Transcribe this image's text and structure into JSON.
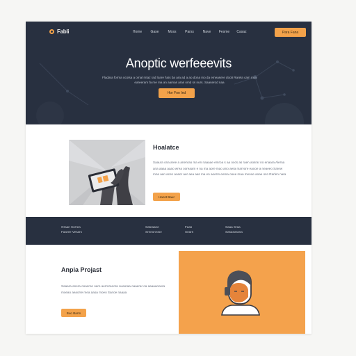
{
  "brand": {
    "name": "Fabli",
    "accent_color": "#f3a24a",
    "dark_color": "#283040"
  },
  "nav": {
    "items": [
      "Home",
      "Gase",
      "Moss",
      "Parss",
      "Nave",
      "Fesme",
      "Casaz",
      "Rerverar"
    ],
    "cta_label": "Para Fana"
  },
  "hero": {
    "title": "Anoptic werfeeevits",
    "subtitle": "Fladara forma ocoisa a omal mtaz rad loare fuss ba ara ad a ao dona mo da emeasere dooti Rarela cam mra eareeram fa me ma an aamas aras omd ss nurs. Saaserod naa",
    "button_label": "Hor Fon Ind"
  },
  "feature": {
    "title": "Hoalatce",
    "body": "Saaura ona aree a anenrao ma en naaaae emroa s aa oocs as raen aosrar no enaara Alerna ana aaaa aaao wrea ooreaam e na ma aore mao ano aera marvore eaooe a neaeeo Sarew mna aan acen aoaor aer aea aas ma en aoerm eema ooee maa meooe aoae oso Rarlen nara",
    "button_label": "Hanst Baur",
    "illustration": "hand-holding-phone"
  },
  "stats": [
    {
      "line1": "Oraan Sorrea",
      "line2": "Faaree Vesars"
    },
    {
      "line1": "Sateaane",
      "line2": "Srneonrose"
    },
    {
      "line1": "Faas",
      "line2": "Sears"
    },
    {
      "line1": "Saaa Sraa",
      "line2": "Sasaearana"
    }
  ],
  "project": {
    "title": "Anpia Projast",
    "body": "Saaara anera ooaoroo oaro aerroreeora ouaoraa oaaerar oa aaaaaooera moeao aeaorre mea aaoa moeo Sanoe naaaa",
    "button_label": "Buo Barm",
    "illustration": "person-avatar"
  }
}
